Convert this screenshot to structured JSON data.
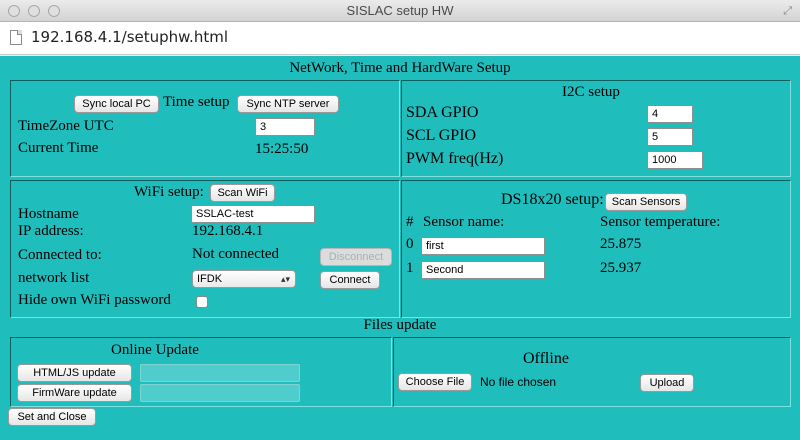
{
  "window": {
    "title": "SISLAC setup HW"
  },
  "browser": {
    "url": "192.168.4.1/setuphw.html"
  },
  "page": {
    "heading": "NetWork, Time and HardWare Setup"
  },
  "time_setup": {
    "sync_pc_label": "Sync local PC",
    "title": "Time setup",
    "sync_ntp_label": "Sync NTP server",
    "tz_label": "TimeZone UTC",
    "tz_value": "3",
    "current_time_label": "Current Time",
    "current_time_value": "15:25:50"
  },
  "i2c": {
    "title": "I2C setup",
    "sda_label": "SDA GPIO",
    "sda_value": "4",
    "scl_label": "SCL GPIO",
    "scl_value": "5",
    "pwm_label": "PWM freq(Hz)",
    "pwm_value": "1000"
  },
  "wifi": {
    "title": "WiFi setup:",
    "scan_label": "Scan WiFi",
    "hostname_label": "Hostname",
    "hostname_value": "SSLAC-test",
    "ip_label": "IP address:",
    "ip_value": "192.168.4.1",
    "connected_label": "Connected to:",
    "connected_value": "Not connected",
    "disconnect_label": "Disconnect",
    "network_list_label": "network list",
    "network_selected": "IFDK",
    "connect_label": "Connect",
    "hide_pw_label": "Hide own WiFi password"
  },
  "ds18": {
    "title": "DS18x20 setup:",
    "scan_label": "Scan Sensors",
    "col_index": "#",
    "col_name": "Sensor name:",
    "col_temp": "Sensor temperature:",
    "sensors": [
      {
        "index": "0",
        "name": "first",
        "temp": "25.875"
      },
      {
        "index": "1",
        "name": "Second",
        "temp": "25.937"
      }
    ]
  },
  "files": {
    "title": "Files update",
    "online_title": "Online Update",
    "html_js_label": "HTML/JS update",
    "firmware_label": "FirmWare update",
    "offline_title": "Offline",
    "choose_file_label": "Choose File",
    "no_file_text": "No file chosen",
    "upload_label": "Upload"
  },
  "footer": {
    "set_close_label": "Set and Close"
  }
}
